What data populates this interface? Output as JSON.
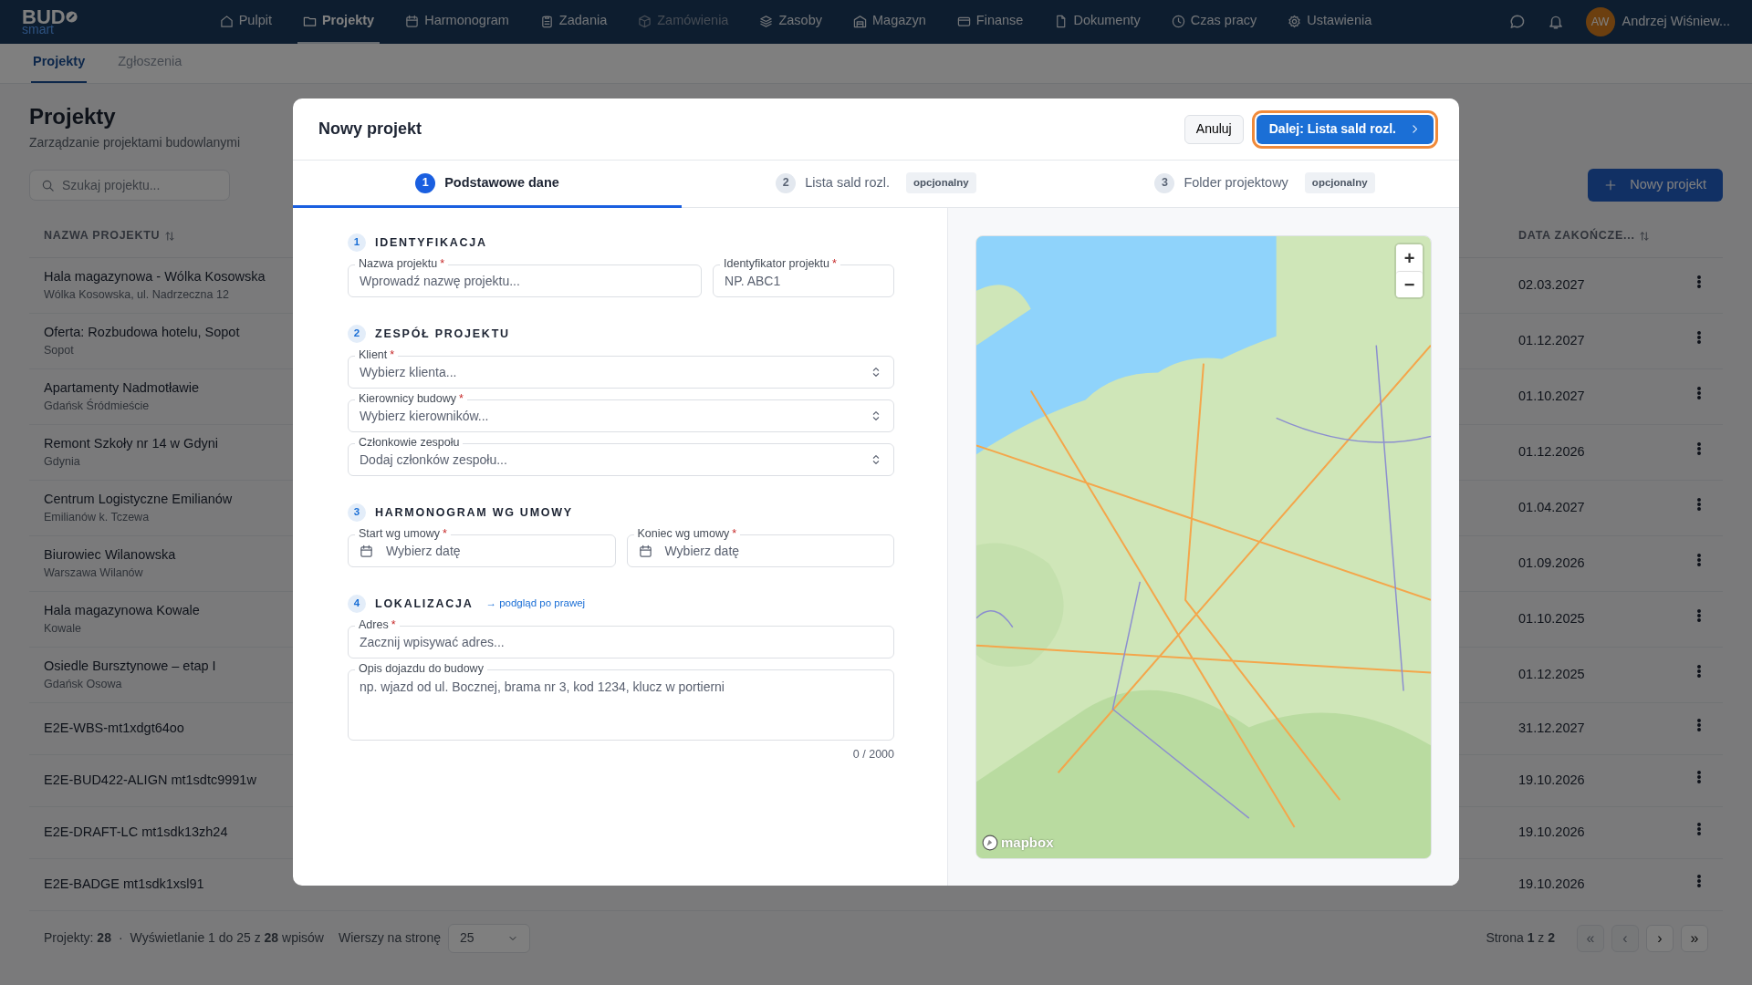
{
  "app": {
    "logo": "BUD",
    "logo_sub": "smart"
  },
  "nav": [
    {
      "label": "Pulpit",
      "selected": false,
      "disabled": false
    },
    {
      "label": "Projekty",
      "selected": true,
      "disabled": false
    },
    {
      "label": "Harmonogram",
      "selected": false,
      "disabled": false
    },
    {
      "label": "Zadania",
      "selected": false,
      "disabled": false
    },
    {
      "label": "Zamówienia",
      "selected": false,
      "disabled": true
    },
    {
      "label": "Zasoby",
      "selected": false,
      "disabled": false
    },
    {
      "label": "Magazyn",
      "selected": false,
      "disabled": false
    },
    {
      "label": "Finanse",
      "selected": false,
      "disabled": false
    },
    {
      "label": "Dokumenty",
      "selected": false,
      "disabled": false
    },
    {
      "label": "Czas pracy",
      "selected": false,
      "disabled": false
    },
    {
      "label": "Ustawienia",
      "selected": false,
      "disabled": false
    }
  ],
  "user": {
    "initials": "AW",
    "name": "Andrzej Wiśniew..."
  },
  "subtabs": [
    {
      "label": "Projekty",
      "selected": true
    },
    {
      "label": "Zgłoszenia",
      "selected": false
    }
  ],
  "page": {
    "title": "Projekty",
    "subtitle": "Zarządzanie projektami budowlanymi",
    "search_placeholder": "Szukaj projektu...",
    "new_button": "Nowy projekt"
  },
  "table": {
    "columns": [
      "NAZWA PROJEKTU",
      "DATA ZAKOŃCZE..."
    ],
    "rows": [
      {
        "name": "Hala magazynowa - Wólka Kosowska",
        "location": "Wólka Kosowska, ul. Nadrzeczna 12",
        "end_date": "02.03.2027"
      },
      {
        "name": "Oferta: Rozbudowa hotelu, Sopot",
        "location": "Sopot",
        "end_date": "01.12.2027"
      },
      {
        "name": "Apartamenty Nadmotławie",
        "location": "Gdańsk Śródmieście",
        "end_date": "01.10.2027"
      },
      {
        "name": "Remont Szkoły nr 14 w Gdyni",
        "location": "Gdynia",
        "end_date": "01.12.2026"
      },
      {
        "name": "Centrum Logistyczne Emilianów",
        "location": "Emilianów k. Tczewa",
        "end_date": "01.04.2027"
      },
      {
        "name": "Biurowiec Wilanowska",
        "location": "Warszawa Wilanów",
        "end_date": "01.09.2026"
      },
      {
        "name": "Hala magazynowa Kowale",
        "location": "Kowale",
        "end_date": "01.10.2025"
      },
      {
        "name": "Osiedle Bursztynowe – etap I",
        "location": "Gdańsk Osowa",
        "end_date": "01.12.2025"
      },
      {
        "name": "E2E-WBS-mt1xdgt64oo",
        "end_date": "31.12.2027"
      },
      {
        "name": "E2E-BUD422-ALIGN mt1sdtc9991w",
        "end_date": "19.10.2026"
      },
      {
        "name": "E2E-DRAFT-LC mt1sdk13zh24",
        "end_date": "19.10.2026"
      },
      {
        "name": "E2E-BADGE mt1sdk1xsl91",
        "end_date": "19.10.2026"
      }
    ]
  },
  "pagination": {
    "count": "Projekty: **28**",
    "sep": "·",
    "summary": "Wyświetlanie 1 do 25 z **28** wpisów",
    "rows_label": "Wierszy na stronę",
    "rows_value": "25",
    "page_text": "Strona **1** z **2**",
    "buttons": [
      {
        "glyph": "«",
        "disabled": true
      },
      {
        "glyph": "‹",
        "disabled": true
      },
      {
        "glyph": "›",
        "disabled": false
      },
      {
        "glyph": "»",
        "disabled": false
      }
    ]
  },
  "modal": {
    "title": "Nowy projekt",
    "cancel": "Anuluj",
    "next": "Dalej: Lista sald rozl.",
    "steps": [
      {
        "number": "1",
        "label": "Podstawowe dane",
        "selected": true
      },
      {
        "number": "2",
        "label": "Lista sald rozl.",
        "badge": "opcjonalny",
        "selected": false
      },
      {
        "number": "3",
        "label": "Folder projektowy",
        "badge": "opcjonalny",
        "selected": false
      }
    ],
    "sections": [
      {
        "number": "1",
        "title": "IDENTYFIKACJA",
        "rows": [
          [
            {
              "kind": "text",
              "label": "Nazwa projektu",
              "mark": "*",
              "placeholder": "Wprowadź nazwę projektu..."
            },
            {
              "kind": "text",
              "label": "Identyfikator projektu",
              "mark": "*",
              "placeholder": "NP. ABC1"
            }
          ]
        ]
      },
      {
        "number": "2",
        "title": "ZESPÓŁ PROJEKTU",
        "rows": [
          [
            {
              "kind": "select",
              "label": "Klient",
              "mark": "*",
              "placeholder": "Wybierz klienta..."
            }
          ],
          [
            {
              "kind": "select",
              "label": "Kierownicy budowy",
              "mark": "*",
              "placeholder": "Wybierz kierowników..."
            }
          ],
          [
            {
              "kind": "select",
              "label": "Członkowie zespołu",
              "placeholder": "Dodaj członków zespołu..."
            }
          ]
        ]
      },
      {
        "number": "3",
        "title": "HARMONOGRAM WG UMOWY",
        "rows": [
          [
            {
              "kind": "date",
              "label": "Start wg umowy",
              "mark": "*",
              "placeholder": "Wybierz datę"
            },
            {
              "kind": "date",
              "label": "Koniec wg umowy",
              "mark": "*",
              "placeholder": "Wybierz datę"
            }
          ]
        ]
      },
      {
        "number": "4",
        "title": "LOKALIZACJA",
        "link": "→ podgląd po prawej",
        "rows": [
          [
            {
              "kind": "text",
              "label": "Adres",
              "mark": "*",
              "placeholder": "Zacznij wpisywać adres..."
            }
          ],
          [
            {
              "kind": "textarea",
              "label": "Opis dojazdu do budowy",
              "placeholder": "np. wjazd od ul. Bocznej, brama nr 3, kod 1234, klucz w portierni",
              "counter": "0 / 2000"
            }
          ]
        ]
      }
    ],
    "map": {
      "kind": "picture",
      "zoom_in": "+",
      "zoom_out": "−",
      "attribution": "mapbox"
    }
  }
}
